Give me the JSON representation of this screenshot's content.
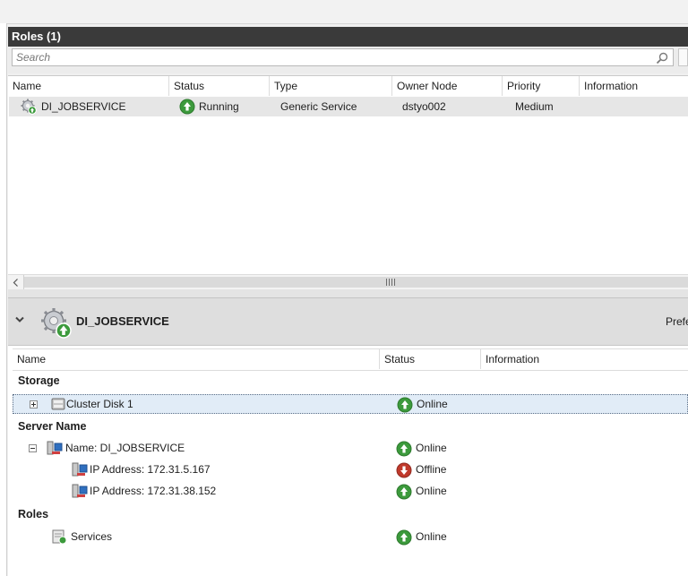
{
  "roles_panel": {
    "title": "Roles (1)",
    "search_placeholder": "Search",
    "columns": [
      "Name",
      "Status",
      "Type",
      "Owner Node",
      "Priority",
      "Information"
    ],
    "rows": [
      {
        "name": "DI_JOBSERVICE",
        "status": "Running",
        "type": "Generic Service",
        "owner_node": "dstyo002",
        "priority": "Medium",
        "information": ""
      }
    ]
  },
  "details": {
    "title": "DI_JOBSERVICE",
    "truncated_label": "Prefe",
    "columns": [
      "Name",
      "Status",
      "Information"
    ],
    "groups": {
      "storage": "Storage",
      "server_name": "Server Name",
      "roles": "Roles"
    },
    "resources": {
      "cluster_disk": {
        "name": "Cluster Disk 1",
        "status": "Online"
      },
      "name_resource": {
        "name": "Name: DI_JOBSERVICE",
        "status": "Online"
      },
      "ip1": {
        "name": "IP Address: 172.31.5.167",
        "status": "Offline"
      },
      "ip2": {
        "name": "IP Address: 172.31.38.152",
        "status": "Online"
      },
      "services": {
        "name": "Services",
        "status": "Online"
      }
    }
  },
  "colors": {
    "header_dark": "#3a3a3a",
    "online_green": "#3c9a3c",
    "offline_red": "#c0392b",
    "selection": "#e1ecf7"
  }
}
